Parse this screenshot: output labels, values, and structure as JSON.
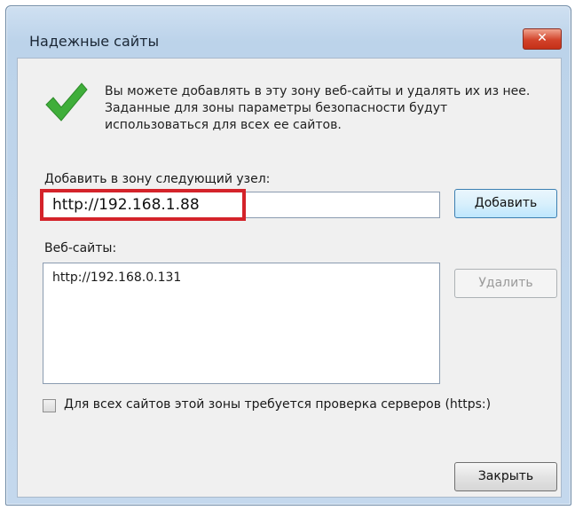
{
  "window": {
    "title": "Надежные сайты",
    "close_glyph": "✕"
  },
  "intro": {
    "icon": "check-icon",
    "text": "Вы можете добавлять в эту зону  веб-сайты и удалять их из нее. Заданные для зоны параметры безопасности будут использоваться для всех ее сайтов."
  },
  "add_site": {
    "label": "Добавить в зону следующий узел:",
    "value": "http://192.168.1.88",
    "button": "Добавить"
  },
  "websites": {
    "label": "Веб-сайты:",
    "items": [
      "http://192.168.0.131"
    ],
    "remove_button": "Удалить"
  },
  "https_check": {
    "label": "Для всех сайтов этой зоны требуется проверка серверов (https:)",
    "checked": false
  },
  "footer": {
    "close_button": "Закрыть"
  },
  "colors": {
    "highlight": "#d4232a",
    "check": "#3fae3a"
  }
}
